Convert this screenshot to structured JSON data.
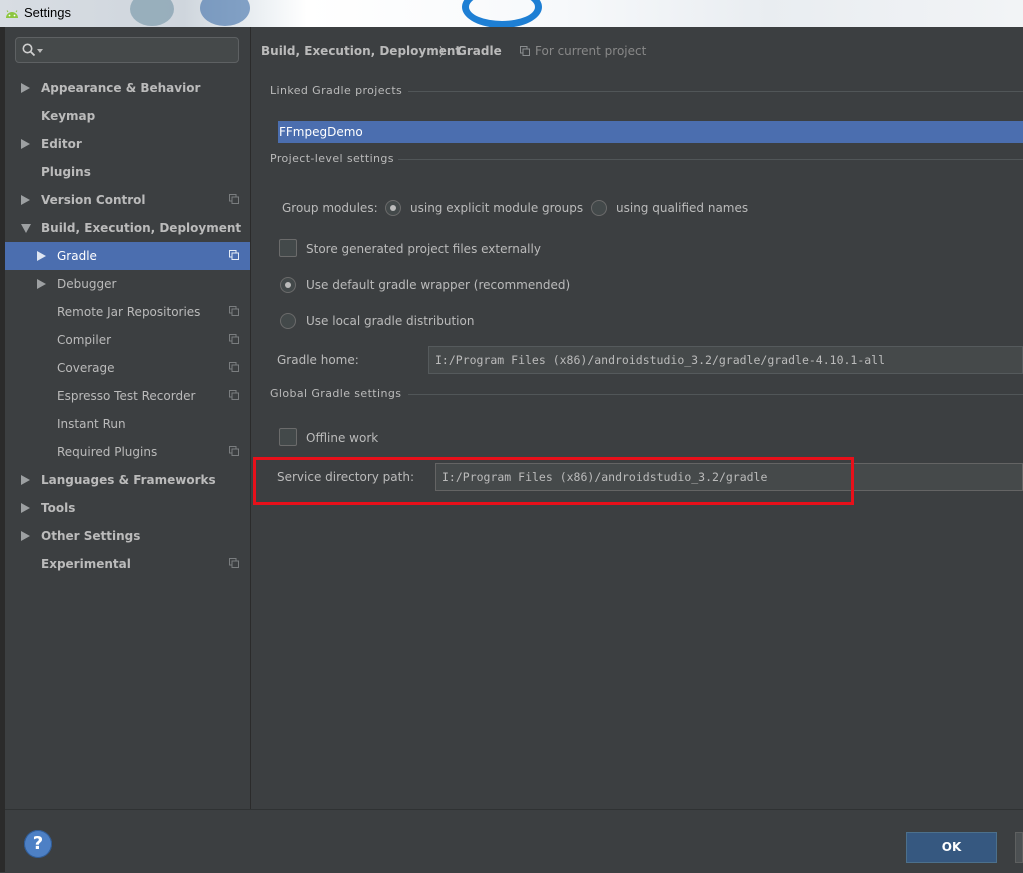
{
  "window": {
    "title": "Settings"
  },
  "search": {
    "value": "",
    "placeholder": ""
  },
  "sidebar": {
    "items": [
      {
        "label": "Appearance & Behavior"
      },
      {
        "label": "Keymap"
      },
      {
        "label": "Editor"
      },
      {
        "label": "Plugins"
      },
      {
        "label": "Version Control"
      },
      {
        "label": "Build, Execution, Deployment"
      },
      {
        "label": "Gradle"
      },
      {
        "label": "Debugger"
      },
      {
        "label": "Remote Jar Repositories"
      },
      {
        "label": "Compiler"
      },
      {
        "label": "Coverage"
      },
      {
        "label": "Espresso Test Recorder"
      },
      {
        "label": "Instant Run"
      },
      {
        "label": "Required Plugins"
      },
      {
        "label": "Languages & Frameworks"
      },
      {
        "label": "Tools"
      },
      {
        "label": "Other Settings"
      },
      {
        "label": "Experimental"
      }
    ]
  },
  "breadcrumb": {
    "parent": "Build, Execution, Deployment",
    "separator": "〉",
    "current": "Gradle",
    "scope": "For current project"
  },
  "linked_projects": {
    "title": "Linked Gradle projects",
    "items": [
      "FFmpegDemo"
    ]
  },
  "project_settings": {
    "title": "Project-level settings",
    "group_modules_label": "Group modules:",
    "option_explicit": "using explicit module groups",
    "option_qualified": "using qualified names",
    "store_externally": "Store generated project files externally",
    "use_default_wrapper": "Use default gradle wrapper (recommended)",
    "use_local_distribution": "Use local gradle distribution",
    "gradle_home_label": "Gradle home:",
    "gradle_home_value": "I:/Program Files (x86)/androidstudio_3.2/gradle/gradle-4.10.1-all"
  },
  "global_settings": {
    "title": "Global Gradle settings",
    "offline_work": "Offline work",
    "service_dir_label": "Service directory path:",
    "service_dir_value": "I:/Program Files (x86)/androidstudio_3.2/gradle"
  },
  "footer": {
    "help": "?",
    "ok": "OK"
  },
  "colors": {
    "selection": "#4b6eaf",
    "background": "#3c3f41",
    "highlight": "#e8101a",
    "ok_button": "#365880"
  }
}
